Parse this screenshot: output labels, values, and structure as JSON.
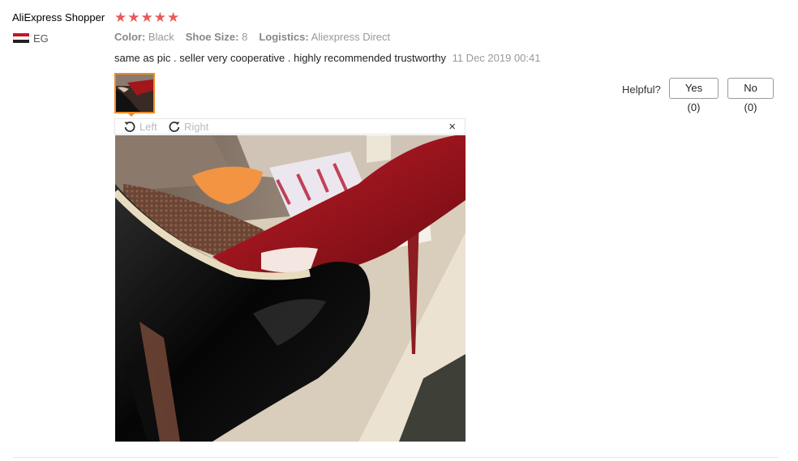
{
  "reviewer": {
    "name": "AliExpress Shopper",
    "country": "EG",
    "rating": 5
  },
  "attributes": [
    {
      "label": "Color:",
      "value": "Black"
    },
    {
      "label": "Shoe Size:",
      "value": "8"
    },
    {
      "label": "Logistics:",
      "value": "Aliexpress Direct"
    }
  ],
  "review": {
    "text": "same as pic . seller very cooperative . highly recommended trustworthy",
    "date": "11 Dec 2019 00:41"
  },
  "helpful": {
    "label": "Helpful?",
    "yes_label": "Yes (0)",
    "no_label": "No (0)"
  },
  "viewer": {
    "left_label": "Left",
    "right_label": "Right",
    "close_glyph": "×"
  },
  "colors": {
    "star": "#e85a5a",
    "thumb_border": "#f08a24"
  }
}
